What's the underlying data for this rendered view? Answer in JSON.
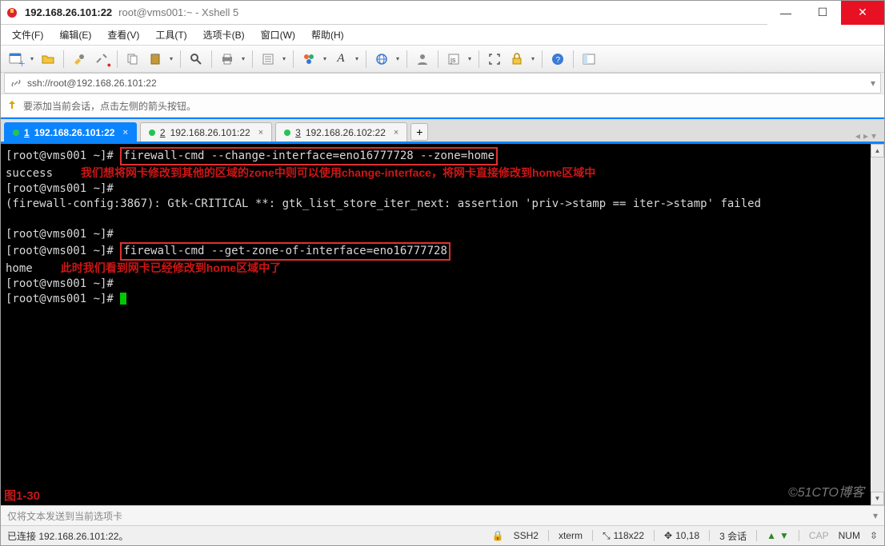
{
  "title": {
    "strong": "192.168.26.101:22",
    "rest": "root@vms001:~ - Xshell 5"
  },
  "menu": {
    "file": "文件(F)",
    "edit": "编辑(E)",
    "view": "查看(V)",
    "tools": "工具(T)",
    "tabs": "选项卡(B)",
    "window": "窗口(W)",
    "help": "帮助(H)"
  },
  "address": {
    "icon": "link-icon",
    "text": "ssh://root@192.168.26.101:22"
  },
  "hint": {
    "text": "要添加当前会话，点击左侧的箭头按钮。"
  },
  "tabs": {
    "items": [
      {
        "num": "1",
        "label": "192.168.26.101:22",
        "status": "green",
        "active": true
      },
      {
        "num": "2",
        "label": "192.168.26.101:22",
        "status": "green",
        "active": false
      },
      {
        "num": "3",
        "label": "192.168.26.102:22",
        "status": "green",
        "active": false
      }
    ],
    "add": "+"
  },
  "terminal": {
    "lines": {
      "p1": "[root@vms001 ~]# ",
      "c1": "firewall-cmd --change-interface=eno16777728 --zone=home",
      "l2": "success",
      "a1": "         我们想将网卡修改到其他的区域的zone中则可以使用change-interface，将网卡直接修改到home区域中",
      "p2": "[root@vms001 ~]# ",
      "l3": "(firewall-config:3867): Gtk-CRITICAL **: gtk_list_store_iter_next: assertion 'priv->stamp == iter->stamp' failed",
      "l4": "",
      "p3": "[root@vms001 ~]# ",
      "p4": "[root@vms001 ~]# ",
      "c2": "firewall-cmd --get-zone-of-interface=eno16777728",
      "l5": "home",
      "a2": "         此时我们看到网卡已经修改到home区域中了",
      "p5": "[root@vms001 ~]# ",
      "p6": "[root@vms001 ~]# "
    },
    "fig_label": "图1-30",
    "watermark": "©51CTO博客"
  },
  "sendbar": {
    "placeholder": "仅将文本发送到当前选项卡"
  },
  "status": {
    "conn": "已连接 192.168.26.101:22。",
    "proto": "SSH2",
    "term": "xterm",
    "size": "118x22",
    "cursor": "10,18",
    "sessions": "3 会话",
    "updown": "⇅",
    "lock": "🔒",
    "cap": "CAP",
    "num": "NUM",
    "updown_icon": "↕"
  },
  "icons": {
    "app": "xshell",
    "min": "—",
    "max": "☐",
    "close": "✕"
  }
}
